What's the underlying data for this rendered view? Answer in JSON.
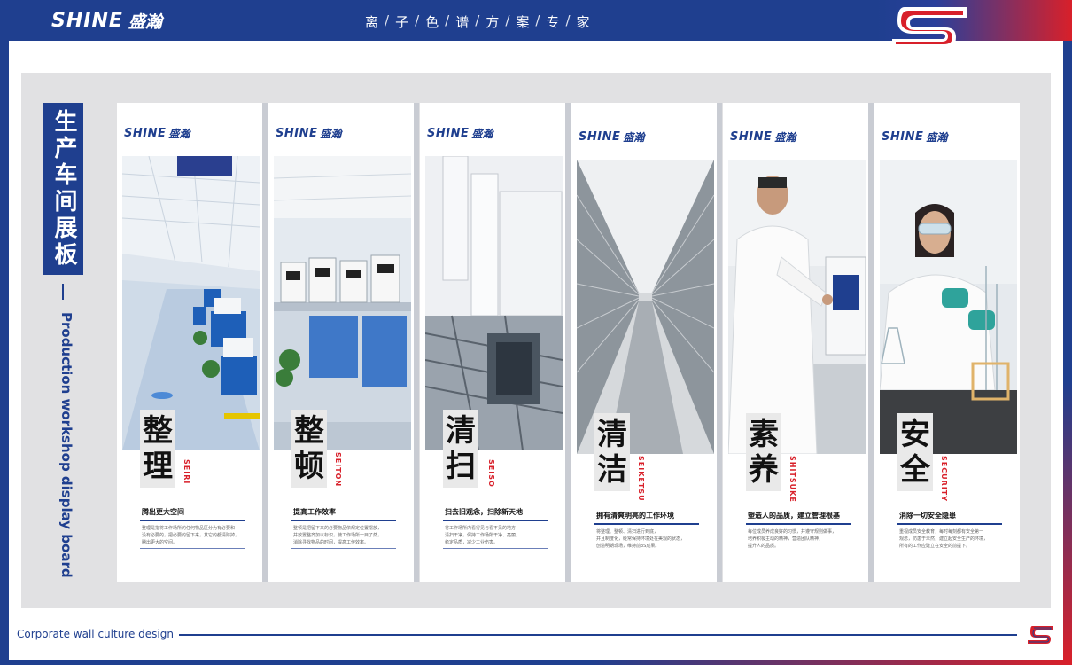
{
  "header": {
    "brand_en": "SHINE",
    "brand_cn": "盛瀚",
    "slogan": [
      "离",
      "子",
      "色",
      "谱",
      "方",
      "案",
      "专",
      "家"
    ]
  },
  "side": {
    "title": "生产车间展板",
    "subtitle": "Production workshop display board"
  },
  "panels": [
    {
      "brand_en": "SHINE",
      "brand_cn": "盛瀚",
      "char1": "整",
      "char2": "理",
      "roman": "SEIRI",
      "caption": "腾出更大空间",
      "desc": [
        "整理是指将工作场所的任何物品区分为有必要和",
        "没有必要的，把必要的留下来，其它的都清除掉，",
        "腾出更大的空间。"
      ]
    },
    {
      "brand_en": "SHINE",
      "brand_cn": "盛瀚",
      "char1": "整",
      "char2": "顿",
      "roman": "SEITON",
      "caption": "提高工作效率",
      "desc": [
        "整顿是把留下来的必要物品依规定位置摆放，",
        "并放置整齐加以标识，使工作场所一目了然，",
        "消除寻找物品的时间，提高工作效率。"
      ]
    },
    {
      "brand_en": "SHINE",
      "brand_cn": "盛瀚",
      "char1": "清",
      "char2": "扫",
      "roman": "SEISO",
      "caption": "扫去旧观念，扫除新天地",
      "desc": [
        "将工作场所内看得见与看不见的地方",
        "清扫干净，保持工作场所干净、亮丽，",
        "稳定品质，减少工业伤害。"
      ]
    },
    {
      "brand_en": "SHINE",
      "brand_cn": "盛瀚",
      "char1": "清",
      "char2": "洁",
      "roman": "SEIKETSU",
      "caption": "拥有清爽明亮的工作环境",
      "desc": [
        "将整理、整顿、清扫进行到底，",
        "并且制度化，经常保持环境处在美观的状态，",
        "创造明朗现场，维持前3S成果。"
      ]
    },
    {
      "brand_en": "SHINE",
      "brand_cn": "盛瀚",
      "char1": "素",
      "char2": "养",
      "roman": "SHITSUKE",
      "caption": "塑造人的品质，建立管理根基",
      "desc": [
        "每位成员养成良好的习惯，并遵守规则做事，",
        "培养积极主动的精神，营造团队精神，",
        "提升人的品质。"
      ]
    },
    {
      "brand_en": "SHINE",
      "brand_cn": "盛瀚",
      "char1": "安",
      "char2": "全",
      "roman": "SECURITY",
      "caption": "消除一切安全隐患",
      "desc": [
        "重视成员安全教育，每时每刻都有安全第一",
        "观念，防患于未然，建立起安全生产的环境，",
        "所有的工作应建立在安全的前提下。"
      ]
    }
  ],
  "footer": {
    "text": "Corporate wall culture design"
  },
  "colors": {
    "brand_blue": "#1f3f8f",
    "brand_red": "#d8202a",
    "board_gray": "#e1e1e3"
  }
}
